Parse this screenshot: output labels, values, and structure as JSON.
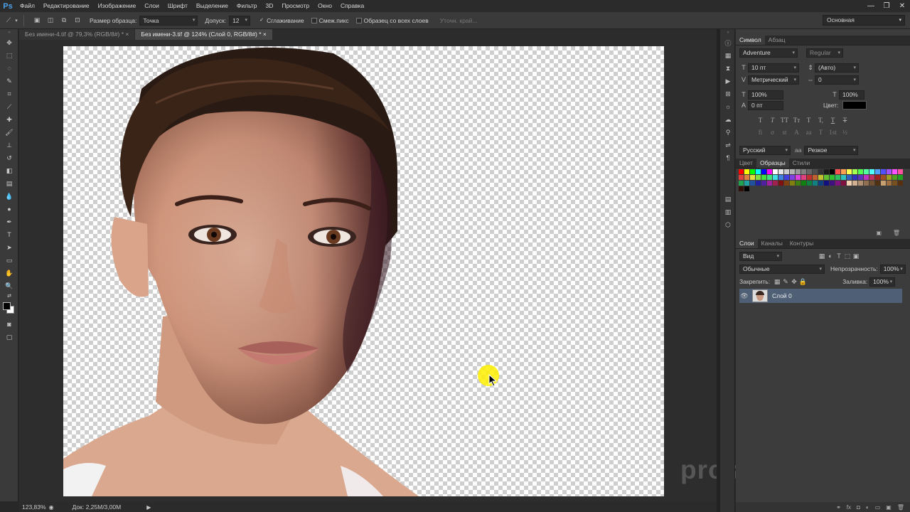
{
  "app": {
    "logo": "Ps"
  },
  "menu": [
    "Файл",
    "Редактирование",
    "Изображение",
    "Слои",
    "Шрифт",
    "Выделение",
    "Фильтр",
    "3D",
    "Просмотр",
    "Окно",
    "Справка"
  ],
  "window_controls": {
    "minimize": "—",
    "restore": "❐",
    "close": "✕"
  },
  "options": {
    "sample_size_label": "Размер образца:",
    "sample_size_value": "Точка",
    "tolerance_label": "Допуск:",
    "tolerance_value": "12",
    "antialias_label": "Сглаживание",
    "antialias_checked": "✓",
    "contiguous_label": "Смеж.пикс",
    "all_layers_label": "Образец со всех слоев",
    "refine_edge_label": "Уточн. край..."
  },
  "workspace": "Основная",
  "tabs": [
    {
      "label": "Без имени-4.tif @ 79,3% (RGB/8#) * ×"
    },
    {
      "label": "Без имени-3.tif @ 124% (Слой 0, RGB/8#) * ×"
    }
  ],
  "status": {
    "zoom": "123,83%",
    "doc": "Док: 2,25M/3,00M"
  },
  "watermark": "prosnys.ru",
  "character": {
    "tabs": [
      "Символ",
      "Абзац"
    ],
    "font_family": "Adventure",
    "font_style": "Regular",
    "font_size": "10 пт",
    "leading": "(Авто)",
    "kerning": "Метрический",
    "tracking": "0",
    "vertical_scale": "100%",
    "horizontal_scale": "100%",
    "baseline": "0 пт",
    "color_label": "Цвет:",
    "language": "Русский",
    "aa_label": "aa",
    "antialias": "Резкое",
    "style_buttons": [
      "T",
      "T",
      "TT",
      "Tт",
      "T",
      "T,",
      "T",
      "T"
    ],
    "glyph_buttons": [
      "fi",
      "σ",
      "st",
      "A",
      "aa",
      "T",
      "1st",
      "½"
    ]
  },
  "swatches": {
    "tabs": [
      "Цвет",
      "Образцы",
      "Стили"
    ],
    "colors": [
      "#ff0000",
      "#ffff00",
      "#00ff00",
      "#00ffff",
      "#0000ff",
      "#ff00ff",
      "#ffffff",
      "#e6e6e6",
      "#cccccc",
      "#b3b3b3",
      "#999999",
      "#808080",
      "#666666",
      "#4d4d4d",
      "#333333",
      "#1a1a1a",
      "#000000",
      "#ff5050",
      "#ffa050",
      "#ffff50",
      "#a0ff50",
      "#50ff50",
      "#50ffa0",
      "#50ffff",
      "#50a0ff",
      "#5050ff",
      "#a050ff",
      "#ff50ff",
      "#ff50a0",
      "#e04040",
      "#e08040",
      "#e0e040",
      "#80e040",
      "#40e040",
      "#40e080",
      "#40e0e0",
      "#4080e0",
      "#4040e0",
      "#8040e0",
      "#e040e0",
      "#e04080",
      "#c03030",
      "#c06030",
      "#c0c030",
      "#60c030",
      "#30c030",
      "#30c060",
      "#30c0c0",
      "#3060c0",
      "#3030c0",
      "#6030c0",
      "#c030c0",
      "#c03060",
      "#a02020",
      "#a05020",
      "#a0a020",
      "#50a020",
      "#20a020",
      "#20a050",
      "#20a0a0",
      "#2050a0",
      "#2020a0",
      "#5020a0",
      "#a020a0",
      "#a02050",
      "#801010",
      "#804010",
      "#808010",
      "#408010",
      "#108010",
      "#108040",
      "#108080",
      "#104080",
      "#101080",
      "#401080",
      "#801080",
      "#801040",
      "#f0d0b0",
      "#d0b090",
      "#b09070",
      "#907050",
      "#705030",
      "#503010",
      "#c8a070",
      "#a07040",
      "#785020",
      "#583010",
      "#301008",
      "#000000"
    ]
  },
  "layers": {
    "tabs": [
      "Слои",
      "Каналы",
      "Контуры"
    ],
    "filter": "Вид",
    "blend_mode": "Обычные",
    "opacity_label": "Непрозрачность:",
    "opacity_value": "100%",
    "lock_label": "Закрепить:",
    "fill_label": "Заливка:",
    "fill_value": "100%",
    "items": [
      {
        "name": "Слой 0",
        "visible_icon": "👁"
      }
    ]
  }
}
